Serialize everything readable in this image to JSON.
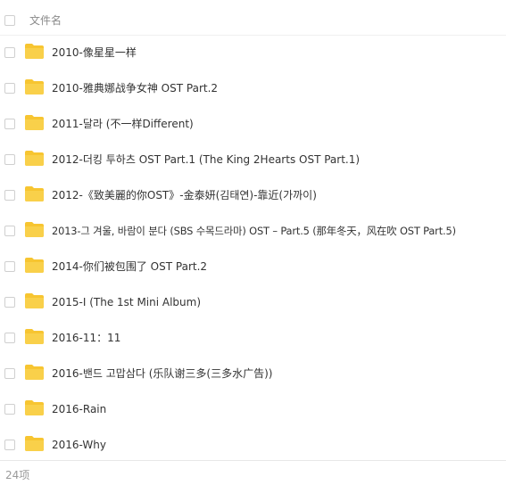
{
  "header": {
    "column_label": "文件名"
  },
  "files": [
    {
      "name": "2010-像星星一样",
      "icon": "folder-icon"
    },
    {
      "name": "2010-雅典娜战争女神 OST Part.2",
      "icon": "folder-icon"
    },
    {
      "name": "2011-달라 (不一样Different)",
      "icon": "folder-icon"
    },
    {
      "name": "2012-더킹 투하츠 OST Part.1 (The King 2Hearts OST Part.1)",
      "icon": "folder-icon"
    },
    {
      "name": "2012-《致美麗的你OST》-金泰妍(김태연)-靠近(가까이)",
      "icon": "folder-icon"
    },
    {
      "name": "2013-그 겨울, 바람이 분다 (SBS 수목드라마) OST – Part.5 (那年冬天，风在吹 OST Part.5)",
      "icon": "folder-icon"
    },
    {
      "name": "2014-你们被包围了 OST Part.2",
      "icon": "folder-icon"
    },
    {
      "name": "2015-I (The 1st Mini Album)",
      "icon": "folder-icon"
    },
    {
      "name": "2016-11：11",
      "icon": "folder-icon"
    },
    {
      "name": "2016-밴드 고맙삼다 (乐队谢三多(三多水广告))",
      "icon": "folder-icon"
    },
    {
      "name": "2016-Rain",
      "icon": "folder-icon"
    },
    {
      "name": "2016-Why",
      "icon": "folder-icon"
    }
  ],
  "footer": {
    "count_label": "24项"
  },
  "colors": {
    "folder": "#f7c531",
    "folder_tab": "#f5b800",
    "text": "#333333",
    "muted": "#8a8a8a"
  }
}
